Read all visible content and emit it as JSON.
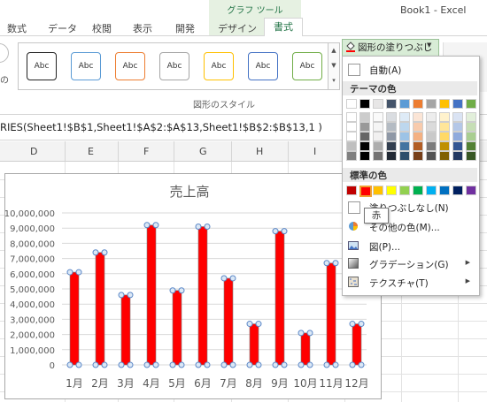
{
  "ribbon": {
    "tabs": [
      "数式",
      "データ",
      "校閲",
      "表示",
      "開発",
      "デザイン",
      "書式"
    ],
    "context_group": "グラフ ツール",
    "active_tab": "書式",
    "doc_title": "Book1 - Excel",
    "left_fragment": "の",
    "style_samples": [
      "Abc",
      "Abc",
      "Abc",
      "Abc",
      "Abc",
      "Abc",
      "Abc"
    ],
    "style_colors": [
      "#222222",
      "#5b9bd5",
      "#ed7d31",
      "#a5a5a5",
      "#ffc000",
      "#4472c4",
      "#70ad47"
    ],
    "group_label": "図形のスタイル",
    "fill_button": "図形の塗りつぶし"
  },
  "formula_bar": {
    "text": "RIES(Sheet1!$B$1,Sheet1!$A$2:$A$13,Sheet1!$B$2:$B$13,1 )"
  },
  "columns": [
    "D",
    "E",
    "F",
    "G",
    "H",
    "I"
  ],
  "dropdown": {
    "auto": "自動(A)",
    "theme_header": "テーマの色",
    "standard_header": "標準の色",
    "no_fill": "塗りつぶしなし(N)",
    "more_colors": "その他の色(M)...",
    "picture": "図(P)...",
    "gradient": "グラデーション(G)",
    "texture": "テクスチャ(T)",
    "tooltip": "赤",
    "theme_colors": [
      "#ffffff",
      "#000000",
      "#e7e6e6",
      "#44546a",
      "#5b9bd5",
      "#ed7d31",
      "#a5a5a5",
      "#ffc000",
      "#4472c4",
      "#70ad47"
    ],
    "standard_colors": [
      "#c00000",
      "#ff0000",
      "#ffc000",
      "#ffff00",
      "#92d050",
      "#00b050",
      "#00b0f0",
      "#0070c0",
      "#002060",
      "#7030a0"
    ]
  },
  "chart_data": {
    "type": "bar",
    "title": "売上高",
    "categories": [
      "1月",
      "2月",
      "3月",
      "4月",
      "5月",
      "6月",
      "7月",
      "8月",
      "9月",
      "10月",
      "11月",
      "12月"
    ],
    "values": [
      6100000,
      7400000,
      4600000,
      9200000,
      4900000,
      9100000,
      5700000,
      2700000,
      8800000,
      2100000,
      6700000,
      2700000
    ],
    "y_ticks": [
      "0",
      "1,000,000",
      "2,000,000",
      "3,000,000",
      "4,000,000",
      "5,000,000",
      "6,000,000",
      "7,000,000",
      "8,000,000",
      "9,000,000",
      "10,000,000"
    ],
    "ylim": [
      0,
      10000000
    ],
    "bar_color": "#ff0000",
    "grid": true
  }
}
